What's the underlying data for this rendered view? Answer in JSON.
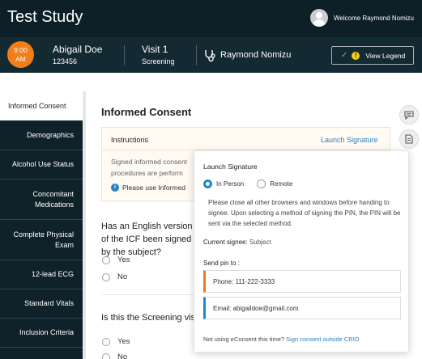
{
  "app": {
    "title": "Test Study",
    "welcome": "Welcome Raymond Nomizu"
  },
  "visit_bar": {
    "time": "9:00",
    "ampm": "AM",
    "patient_name": "Abigail Doe",
    "patient_id": "123456",
    "visit_name": "Visit 1",
    "visit_type": "Screening",
    "investigator": "Raymond Nomizu",
    "legend_button": "View Legend",
    "legend_icon": "!"
  },
  "sidebar": {
    "items": [
      {
        "label": "Informed Consent",
        "active": true
      },
      {
        "label": "Demographics"
      },
      {
        "label": "Alcohol Use Status"
      },
      {
        "label": "Concomitant Medications"
      },
      {
        "label": "Complete Physical Exam"
      },
      {
        "label": "12-lead ECG"
      },
      {
        "label": "Standard Vitals"
      },
      {
        "label": "Inclusion Criteria"
      }
    ]
  },
  "main": {
    "title": "Informed Consent",
    "instructions": {
      "title": "Instructions",
      "launch_link": "Launch Signature",
      "text_line1": "Signed informed consent",
      "text_line2": "procedures are perform",
      "info_icon": "i",
      "note": "Please use Informed C"
    },
    "question1": {
      "text": "Has an English version of the ICF been signed by the subject?",
      "options": [
        "Yes",
        "No"
      ]
    },
    "question2": {
      "text": "Is this the Screening visit?",
      "options": [
        "Yes",
        "No"
      ]
    }
  },
  "popup": {
    "title": "Launch Signature",
    "modes": [
      {
        "label": "In Person",
        "selected": true
      },
      {
        "label": "Remote",
        "selected": false
      }
    ],
    "description": "Please close all other browsers and windows before handing to signee. Upon selecting a method of signing the PIN, the PIN will be sent via the selected method.",
    "current_signee_label": "Current signee:",
    "current_signee_value": "Subject",
    "send_pin_label": "Send pin to :",
    "phone": "Phone: 111-222-3333",
    "email": "Email: abigaildoe@gmail.com",
    "footer_text": "Not using eConsent this time?",
    "footer_link": "Sign consent outside CRIO"
  },
  "colors": {
    "topbar": "#0d1f27",
    "accent_orange": "#f27d1b",
    "link_blue": "#2a7fc0",
    "legend_check": "#38d063",
    "legend_dot": "#f2cc18"
  },
  "icons": [
    "avatar-icon",
    "stethoscope-icon",
    "check-icon",
    "alert-icon",
    "info-icon",
    "comment-icon",
    "document-icon"
  ]
}
